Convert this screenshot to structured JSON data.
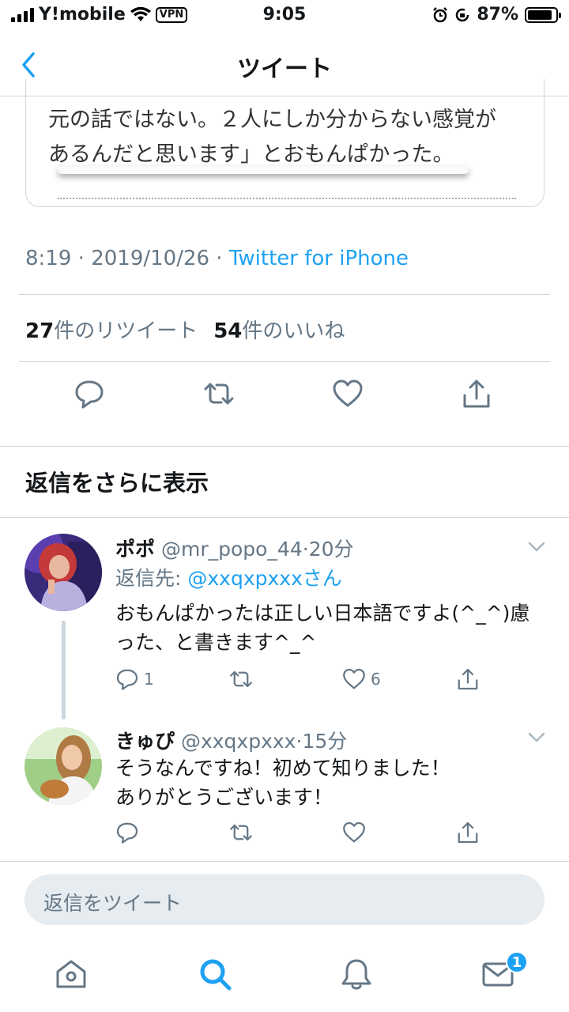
{
  "status_bar": {
    "carrier": "Y!mobile",
    "vpn": "VPN",
    "time": "9:05",
    "battery": "87%",
    "battery_level": 0.87
  },
  "nav": {
    "title": "ツイート",
    "back_icon": "chevron-left-icon"
  },
  "quoted": {
    "line1": "元の話ではない。２人にしか分からない感覚が",
    "line2": "あるんだと思います」とおもんぱかった。"
  },
  "tweet_meta": {
    "time": "8:19",
    "sep1": " · ",
    "date": "2019/10/26",
    "sep2": " · ",
    "via": "Twitter for iPhone"
  },
  "counts": {
    "retweets_num": "27",
    "retweets_label": "件のリツイート",
    "likes_num": "54",
    "likes_label": "件のいいね"
  },
  "more_replies": "返信をさらに表示",
  "replies": [
    {
      "name": "ポポ",
      "handle": "@mr_popo_44",
      "sep": "·",
      "time": "20分",
      "reply_to_label": "返信先: ",
      "reply_to_handle": "@xxqxpxxxさん",
      "body_line1": "おもんぱかったは正しい日本語ですよ(^_^)慮",
      "body_line2": "った、と書きます^_^",
      "reply_count": "1",
      "like_count": "6"
    },
    {
      "name": "きゅぴ",
      "handle": "@xxqxpxxx",
      "sep": "·",
      "time": "15分",
      "body_line1": "そうなんですね！初めて知りました！",
      "body_line2": "ありがとうございます！"
    }
  ],
  "compose": {
    "placeholder": "返信をツイート"
  },
  "tabbar": {
    "items": [
      "home-icon",
      "search-icon",
      "notifications-icon",
      "messages-icon"
    ],
    "messages_badge": "1"
  },
  "colors": {
    "accent": "#1da1f2",
    "muted": "#657786",
    "divider": "#ccd6dd"
  }
}
